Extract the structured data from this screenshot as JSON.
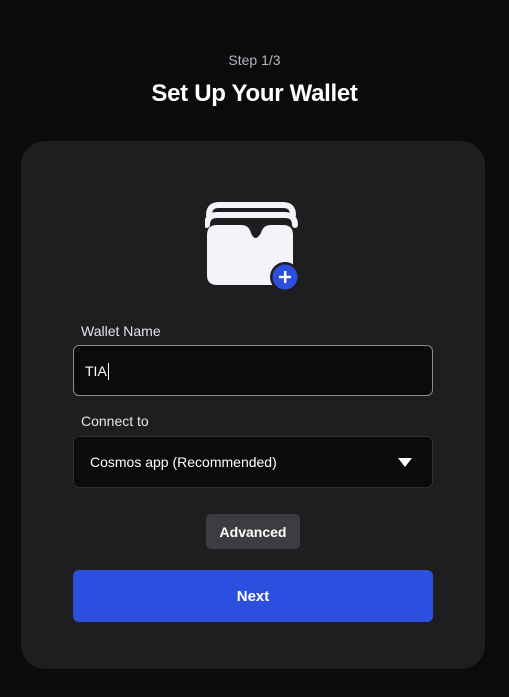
{
  "header": {
    "step": "Step 1/3",
    "title": "Set Up Your Wallet"
  },
  "form": {
    "wallet_name_label": "Wallet Name",
    "wallet_name_value": "TIA",
    "connect_label": "Connect to",
    "connect_value": "Cosmos app (Recommended)",
    "advanced_label": "Advanced",
    "next_label": "Next"
  },
  "icons": {
    "illustration": "wallet-add-icon",
    "dropdown": "chevron-down-icon",
    "badge": "plus-icon"
  },
  "colors": {
    "background": "#0b0b0d",
    "card": "#1e1e21",
    "primary": "#2d4fe0",
    "secondary_button": "#3c3c41"
  }
}
